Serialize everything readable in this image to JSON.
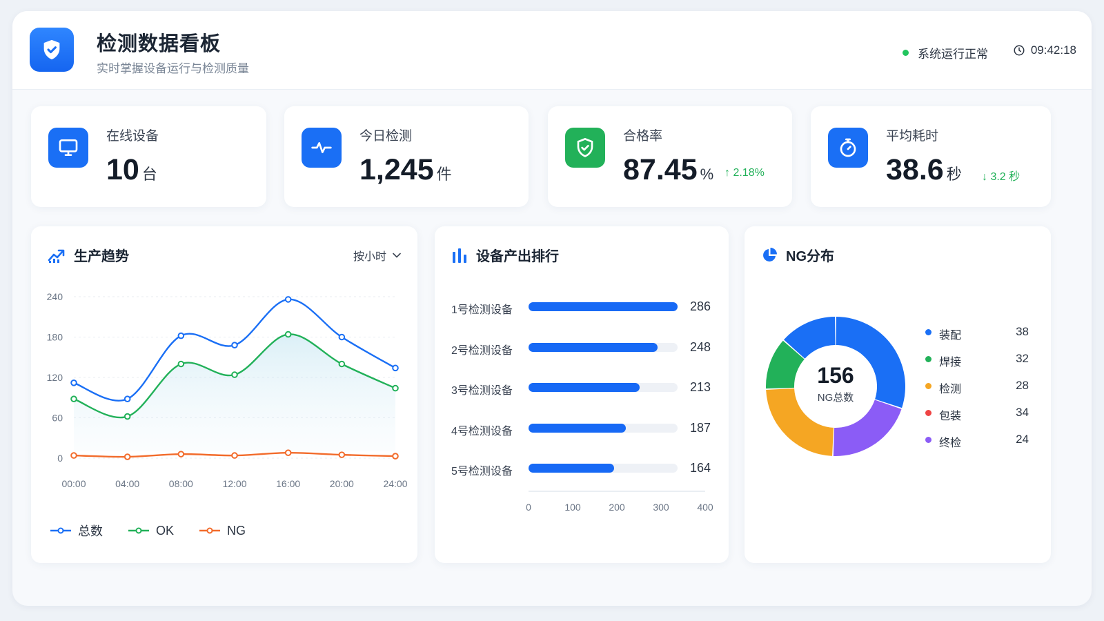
{
  "header": {
    "title": "检测数据看板",
    "subtitle": "实时掌握设备运行与检测质量",
    "status_text": "系统运行正常",
    "time": "09:42:18",
    "logo_icon": "shield-check-icon",
    "clock_icon": "clock-icon"
  },
  "stats": [
    {
      "label": "在线设备",
      "value": "10",
      "unit": "台",
      "icon": "monitor-icon",
      "color": "#1a6ff5"
    },
    {
      "label": "今日检测",
      "value": "1,245",
      "unit": "件",
      "icon": "pulse-icon",
      "color": "#1a6ff5"
    },
    {
      "label": "合格率",
      "value": "87.45",
      "unit": "%",
      "change": "2.18%",
      "change_dir": "up",
      "icon": "shield-check-icon",
      "color": "#22b159"
    },
    {
      "label": "平均耗时",
      "value": "38.6",
      "unit": "秒",
      "change": "3.2 秒",
      "change_dir": "down",
      "icon": "stopwatch-icon",
      "color": "#1a6ff5"
    }
  ],
  "trend": {
    "title": "生产趋势",
    "dropdown": "按小时",
    "legend": [
      "总数",
      "OK",
      "NG"
    ]
  },
  "ranking": {
    "title": "设备产出排行"
  },
  "ng": {
    "title": "NG分布",
    "total": "156",
    "total_label": "NG总数"
  },
  "chart_data": [
    {
      "type": "line",
      "title": "生产趋势",
      "x": [
        "00:00",
        "04:00",
        "08:00",
        "12:00",
        "16:00",
        "20:00",
        "24:00"
      ],
      "ylim": [
        0,
        240
      ],
      "yticks": [
        "0",
        "60",
        "120",
        "180",
        "240"
      ],
      "grid": true,
      "series": [
        {
          "name": "总数",
          "values": [
            112,
            88,
            182,
            168,
            236,
            180,
            134
          ],
          "color": "#1a6ff5"
        },
        {
          "name": "OK",
          "values": [
            88,
            62,
            140,
            124,
            184,
            140,
            104
          ],
          "color": "#22b159"
        },
        {
          "name": "NG",
          "values": [
            4,
            2,
            6,
            4,
            8,
            5,
            3
          ],
          "color": "#f26b2b"
        }
      ]
    },
    {
      "type": "bar",
      "orientation": "horizontal",
      "title": "设备产出排行",
      "categories": [
        "1号检测设备",
        "2号检测设备",
        "3号检测设备",
        "4号检测设备",
        "5号检测设备"
      ],
      "values": [
        286,
        248,
        213,
        187,
        164
      ],
      "xlim": [
        0,
        400
      ],
      "xticks": [
        "0",
        "100",
        "200",
        "300",
        "400"
      ],
      "color": "#1769f5"
    },
    {
      "type": "pie",
      "title": "NG分布",
      "donut": true,
      "categories": [
        "装配",
        "焊接",
        "检测",
        "包装",
        "终检"
      ],
      "values": [
        38,
        32,
        28,
        34,
        24
      ],
      "slice_values": [
        47,
        32,
        37,
        19,
        21
      ],
      "slice_colors": [
        "#1a6ff5",
        "#8b5cf6",
        "#f5a623",
        "#22b159",
        "#1a6ff5"
      ],
      "legend_colors": [
        "#1a6ff5",
        "#22b159",
        "#f5a623",
        "#ef4444",
        "#8b5cf6"
      ]
    }
  ]
}
